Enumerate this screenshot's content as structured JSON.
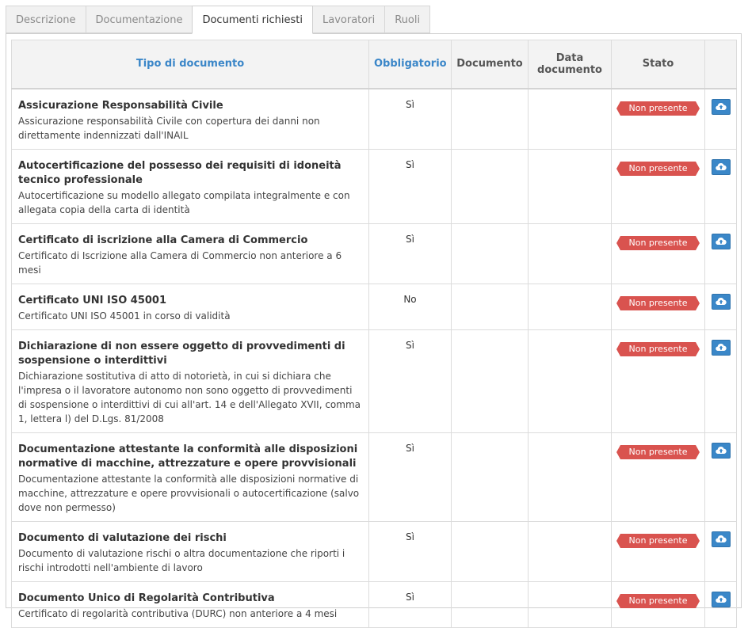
{
  "tabs": [
    {
      "label": "Descrizione",
      "active": false
    },
    {
      "label": "Documentazione",
      "active": false
    },
    {
      "label": "Documenti richiesti",
      "active": true
    },
    {
      "label": "Lavoratori",
      "active": false
    },
    {
      "label": "Ruoli",
      "active": false
    }
  ],
  "table": {
    "headers": {
      "tipo": "Tipo di documento",
      "obbligatorio": "Obbligatorio",
      "documento": "Documento",
      "data": "Data documento",
      "stato": "Stato",
      "azioni": ""
    },
    "rows": [
      {
        "title": "Assicurazione Responsabilità Civile",
        "description": "Assicurazione responsabilità Civile con copertura dei danni non direttamente indennizzati dall'INAIL",
        "required": "Sì",
        "document": "",
        "date": "",
        "status": "Non presente"
      },
      {
        "title": "Autocertificazione del possesso dei requisiti di idoneità tecnico professionale",
        "description": "Autocertificazione su modello allegato compilata integralmente e con allegata copia della carta di identità",
        "required": "Sì",
        "document": "",
        "date": "",
        "status": "Non presente"
      },
      {
        "title": "Certificato di iscrizione alla Camera di Commercio",
        "description": "Certificato di Iscrizione alla Camera di Commercio non anteriore a 6 mesi",
        "required": "Sì",
        "document": "",
        "date": "",
        "status": "Non presente"
      },
      {
        "title": "Certificato UNI ISO 45001",
        "description": "Certificato UNI ISO 45001 in corso di validità",
        "required": "No",
        "document": "",
        "date": "",
        "status": "Non presente"
      },
      {
        "title": "Dichiarazione di non essere oggetto di provvedimenti di sospensione o interdittivi",
        "description": "Dichiarazione sostitutiva di atto di notorietà, in cui si dichiara che l'impresa o il lavoratore autonomo non sono oggetto di provvedimenti di sospensione o interdittivi di cui all'art. 14 e dell'Allegato XVII, comma 1, lettera l) del D.Lgs. 81/2008",
        "required": "Sì",
        "document": "",
        "date": "",
        "status": "Non presente"
      },
      {
        "title": "Documentazione attestante la conformità alle disposizioni normative di macchine, attrezzature e opere provvisionali",
        "description": "Documentazione attestante la conformità alle disposizioni normative di macchine, attrezzature e opere provvisionali o autocertificazione (salvo dove non permesso)",
        "required": "Sì",
        "document": "",
        "date": "",
        "status": "Non presente"
      },
      {
        "title": "Documento di valutazione dei rischi",
        "description": "Documento di valutazione rischi o altra documentazione che riporti i rischi introdotti nell'ambiente di lavoro",
        "required": "Sì",
        "document": "",
        "date": "",
        "status": "Non presente"
      },
      {
        "title": "Documento Unico di Regolarità Contributiva",
        "description": "Certificato di regolarità contributiva (DURC) non anteriore a 4 mesi",
        "required": "Sì",
        "document": "",
        "date": "",
        "status": "Non presente"
      }
    ]
  },
  "colors": {
    "accent": "#3a86c8",
    "status_missing": "#d9534f",
    "upload_button": "#3a87c8"
  },
  "icons": {
    "upload": "cloud-upload-icon"
  }
}
